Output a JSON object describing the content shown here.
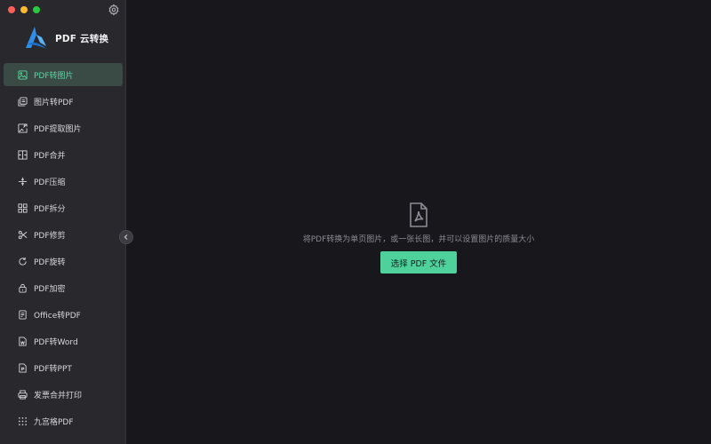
{
  "app": {
    "name": "PDF 云转换",
    "accent_color": "#4fd19b",
    "logo_icon": "app-logo-icon",
    "settings_icon": "gear-icon"
  },
  "sidebar": {
    "items": [
      {
        "label": "PDF转图片",
        "icon": "pdf-to-image-icon",
        "active": true
      },
      {
        "label": "图片转PDF",
        "icon": "image-to-pdf-icon",
        "active": false
      },
      {
        "label": "PDF提取图片",
        "icon": "extract-image-icon",
        "active": false
      },
      {
        "label": "PDF合并",
        "icon": "merge-icon",
        "active": false
      },
      {
        "label": "PDF压缩",
        "icon": "compress-icon",
        "active": false
      },
      {
        "label": "PDF拆分",
        "icon": "split-icon",
        "active": false
      },
      {
        "label": "PDF修剪",
        "icon": "scissors-icon",
        "active": false
      },
      {
        "label": "PDF旋转",
        "icon": "rotate-icon",
        "active": false
      },
      {
        "label": "PDF加密",
        "icon": "lock-icon",
        "active": false
      },
      {
        "label": "Office转PDF",
        "icon": "office-icon",
        "active": false
      },
      {
        "label": "PDF转Word",
        "icon": "word-document-icon",
        "active": false
      },
      {
        "label": "PDF转PPT",
        "icon": "ppt-document-icon",
        "active": false
      },
      {
        "label": "发票合并打印",
        "icon": "printer-icon",
        "active": false
      },
      {
        "label": "九宫格PDF",
        "icon": "grid-icon",
        "active": false
      }
    ],
    "collapse_icon": "chevron-left-icon"
  },
  "main": {
    "icon": "pdf-file-icon",
    "hint": "将PDF转换为单页图片，或一张长图，并可以设置图片的质量大小",
    "button_label": "选择 PDF 文件"
  }
}
